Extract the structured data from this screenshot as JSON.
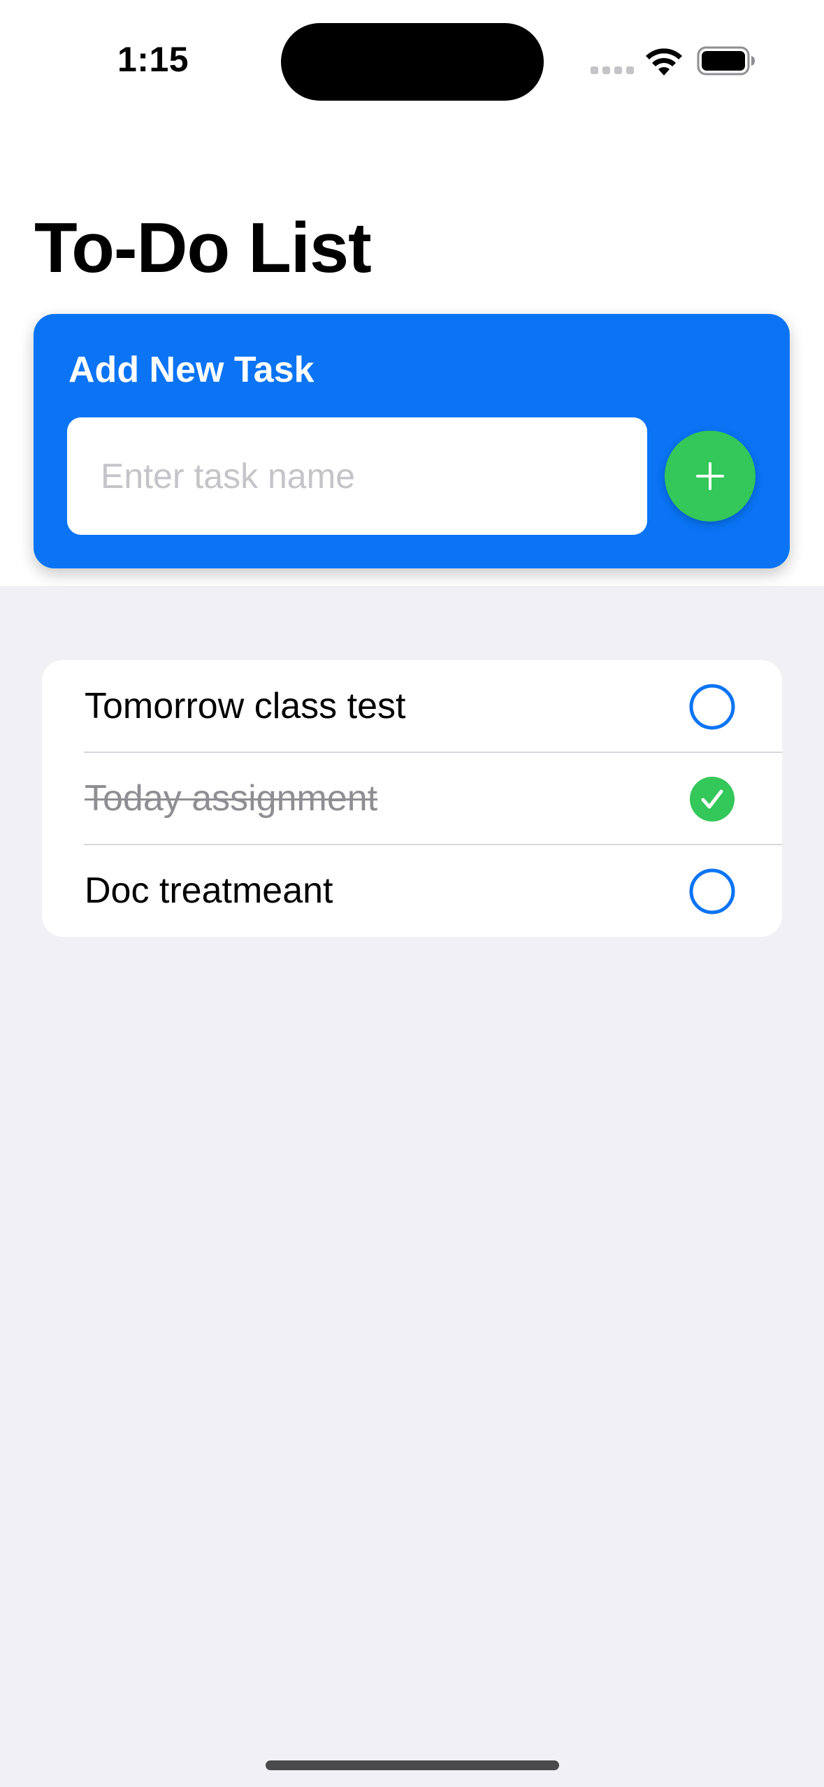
{
  "status_bar": {
    "time": "1:15"
  },
  "header": {
    "title": "To-Do List"
  },
  "add_task": {
    "title": "Add New Task",
    "input_value": "",
    "input_placeholder": "Enter task name",
    "add_button_icon": "plus-icon"
  },
  "tasks": [
    {
      "label": "Tomorrow class test",
      "completed": false
    },
    {
      "label": "Today assignment",
      "completed": true
    },
    {
      "label": "Doc treatmeant",
      "completed": false
    }
  ],
  "colors": {
    "accent_blue": "#0a74f5",
    "success_green": "#34c759",
    "background": "#f0f0f5",
    "completed_text": "#8e8e93"
  }
}
